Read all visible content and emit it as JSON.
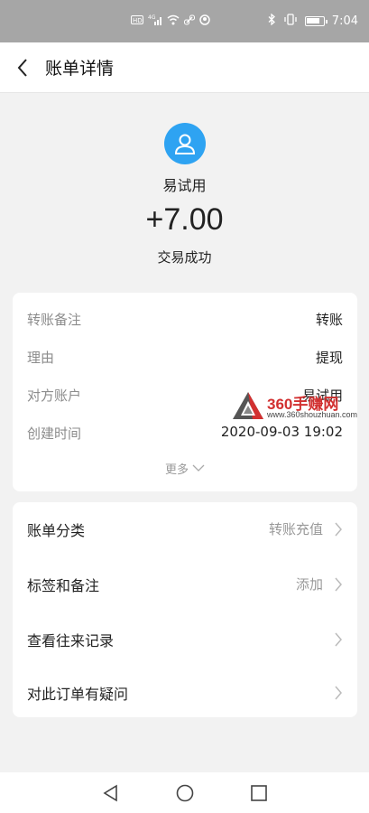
{
  "statusbar": {
    "time": "7:04",
    "network": "4G",
    "icons": [
      "hd-icon",
      "signal-icon",
      "wifi-icon",
      "link-icon",
      "location-icon",
      "bluetooth-icon",
      "vibrate-icon",
      "battery-icon"
    ]
  },
  "titlebar": {
    "title": "账单详情"
  },
  "header": {
    "name": "易试用",
    "amount": "+7.00",
    "status": "交易成功"
  },
  "details": {
    "rows": [
      {
        "label": "转账备注",
        "value": "转账"
      },
      {
        "label": "理由",
        "value": "提现"
      },
      {
        "label": "对方账户",
        "value": "易试用"
      },
      {
        "label": "创建时间",
        "value": "2020-09-03 19:02"
      }
    ],
    "more_label": "更多"
  },
  "watermark": {
    "text": "360手赚网",
    "url": "www.360shouzhuan.com"
  },
  "actions": [
    {
      "label": "账单分类",
      "value": "转账充值"
    },
    {
      "label": "标签和备注",
      "value": "添加"
    },
    {
      "label": "查看往来记录",
      "value": ""
    },
    {
      "label": "对此订单有疑问",
      "value": ""
    }
  ],
  "colors": {
    "accent": "#2ea3f2",
    "statusbar_bg": "#a6a6a6",
    "page_bg": "#f2f2f2"
  }
}
